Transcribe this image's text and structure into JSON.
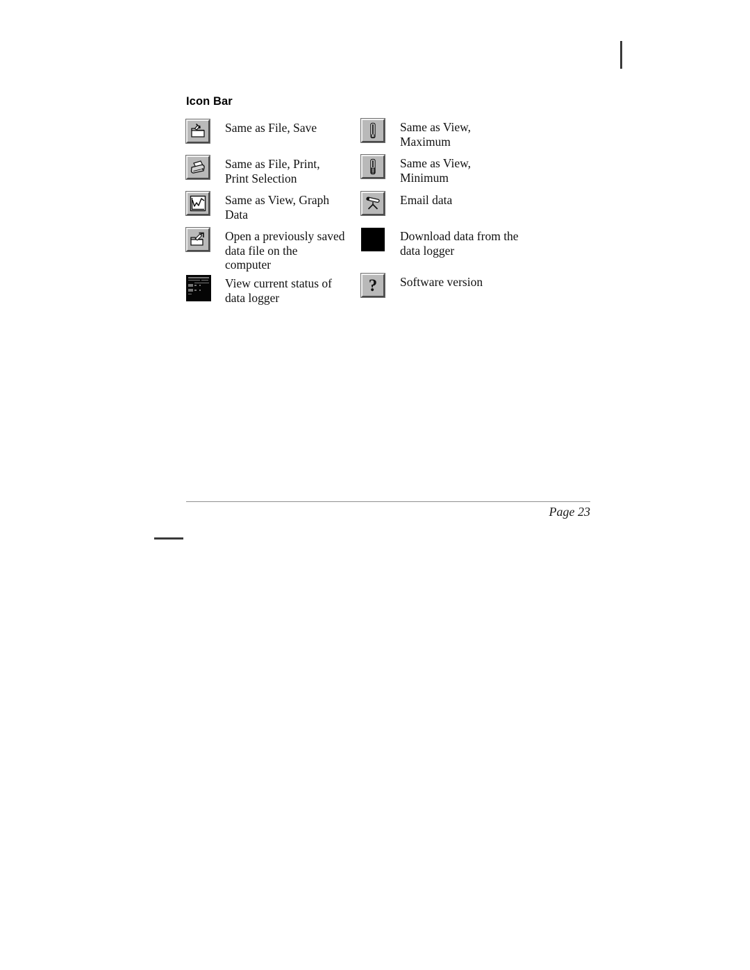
{
  "document": {
    "section_title": "Icon Bar",
    "footer": {
      "page_label": "Page 23"
    }
  },
  "icon_bar": {
    "left_column": [
      {
        "icon": "save-folder-icon",
        "label": "Same as File, Save"
      },
      {
        "icon": "printer-icon",
        "label": "Same as File, Print,\nPrint Selection"
      },
      {
        "icon": "graph-data-icon",
        "label": "Same as View, Graph\nData"
      },
      {
        "icon": "open-folder-icon",
        "label": "Open a previously saved\ndata file on the\ncomputer"
      },
      {
        "icon": "logger-status-display-icon",
        "label": "View current status of\ndata logger"
      }
    ],
    "right_column": [
      {
        "icon": "thermometer-maximum-icon",
        "label": "Same as View,\nMaximum"
      },
      {
        "icon": "thermometer-minimum-icon",
        "label": "Same as View,\nMinimum"
      },
      {
        "icon": "email-data-icon",
        "label": "Email data"
      },
      {
        "icon": "download-data-icon",
        "label": "Download data from the\ndata logger"
      },
      {
        "icon": "software-version-help-icon",
        "label": "Software version"
      }
    ]
  },
  "colors": {
    "page_background": "#ffffff",
    "text": "#111111",
    "button_face": "#b9b9b9",
    "button_highlight": "#f2f2f2",
    "button_shadow": "#4a4a4a",
    "rule": "#8f8f8f",
    "mark": "#3a3a3a"
  }
}
